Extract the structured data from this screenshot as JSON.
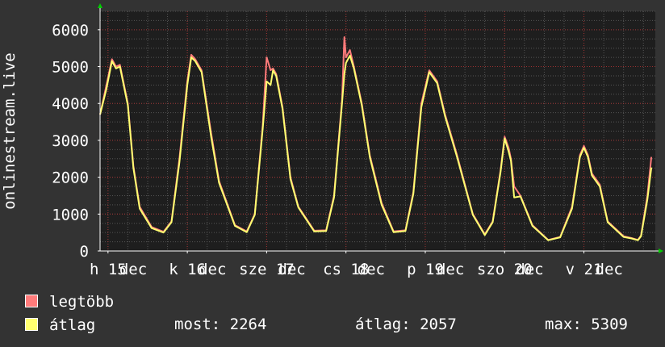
{
  "colors": {
    "background": "#333333",
    "plot": "#1e1e1e",
    "grid": "#555555",
    "major_grid": "#a03030",
    "max_series": "#ff7b7b",
    "avg_series": "#ffff70",
    "arrow": "#00cc00"
  },
  "legend": {
    "max_label": "legtöbb",
    "avg_label": "átlag",
    "now": "most: 2264",
    "average": "átlag: 2057",
    "maximum": "max: 5309"
  },
  "chart_data": {
    "type": "line",
    "ylabel": "onlinestream.live",
    "ylim": [
      0,
      6500
    ],
    "yticks": [
      0,
      1000,
      2000,
      3000,
      4000,
      5000,
      6000
    ],
    "yticklabels": [
      "0",
      "1000",
      "2000",
      "3000",
      "4000",
      "5000",
      "6000"
    ],
    "xlim": [
      -0.1,
      6.9
    ],
    "xticks": [
      0,
      1,
      2,
      3,
      4,
      5,
      6
    ],
    "xticklabels": [
      "h 15",
      "k 16",
      "sze 17",
      "cs 18",
      "p 19",
      "szo 20",
      "v 21"
    ],
    "xrotatedlabels": [
      "dec",
      "dec",
      "dec",
      "dec",
      "dec",
      "dec",
      "dec"
    ],
    "series": [
      {
        "name": "legtöbb",
        "x": [
          -0.1,
          -0.02,
          0.05,
          0.1,
          0.15,
          0.25,
          0.32,
          0.4,
          0.55,
          0.7,
          0.8,
          0.9,
          1.0,
          1.05,
          1.1,
          1.18,
          1.3,
          1.4,
          1.6,
          1.75,
          1.85,
          1.95,
          2.0,
          2.05,
          2.08,
          2.12,
          2.2,
          2.3,
          2.4,
          2.6,
          2.75,
          2.85,
          2.95,
          2.98,
          3.0,
          3.05,
          3.1,
          3.2,
          3.3,
          3.45,
          3.6,
          3.75,
          3.85,
          3.95,
          4.05,
          4.15,
          4.25,
          4.4,
          4.6,
          4.75,
          4.85,
          4.95,
          5.0,
          5.05,
          5.08,
          5.12,
          5.2,
          5.35,
          5.55,
          5.7,
          5.85,
          5.95,
          6.0,
          6.05,
          6.1,
          6.2,
          6.3,
          6.5,
          6.6,
          6.68,
          6.72,
          6.8,
          6.85
        ],
        "values": [
          3700,
          4500,
          5200,
          5000,
          5050,
          4000,
          2300,
          1200,
          650,
          520,
          800,
          2500,
          4600,
          5320,
          5200,
          4900,
          3200,
          1900,
          700,
          530,
          1000,
          3400,
          5250,
          4900,
          4950,
          4800,
          3900,
          2000,
          1200,
          550,
          560,
          1500,
          4100,
          5800,
          5250,
          5450,
          5000,
          4000,
          2600,
          1300,
          530,
          560,
          1600,
          4000,
          4900,
          4600,
          3700,
          2600,
          1000,
          450,
          800,
          2200,
          3100,
          2800,
          2500,
          1750,
          1500,
          700,
          300,
          380,
          1200,
          2600,
          2850,
          2600,
          2100,
          1800,
          800,
          400,
          350,
          300,
          420,
          1500,
          2550
        ]
      },
      {
        "name": "átlag",
        "x": [
          -0.1,
          -0.02,
          0.05,
          0.1,
          0.15,
          0.25,
          0.32,
          0.4,
          0.55,
          0.7,
          0.8,
          0.9,
          1.0,
          1.05,
          1.1,
          1.18,
          1.3,
          1.4,
          1.6,
          1.75,
          1.85,
          1.95,
          2.0,
          2.05,
          2.08,
          2.12,
          2.2,
          2.3,
          2.4,
          2.6,
          2.75,
          2.85,
          2.95,
          2.98,
          3.0,
          3.05,
          3.1,
          3.2,
          3.3,
          3.45,
          3.6,
          3.75,
          3.85,
          3.95,
          4.05,
          4.15,
          4.25,
          4.4,
          4.6,
          4.75,
          4.85,
          4.95,
          5.0,
          5.05,
          5.08,
          5.12,
          5.2,
          5.35,
          5.55,
          5.7,
          5.85,
          5.95,
          6.0,
          6.05,
          6.1,
          6.2,
          6.3,
          6.5,
          6.6,
          6.68,
          6.72,
          6.8,
          6.85
        ],
        "values": [
          3700,
          4400,
          5150,
          4950,
          5000,
          3950,
          2250,
          1150,
          620,
          500,
          780,
          2400,
          4500,
          5250,
          5150,
          4850,
          3100,
          1850,
          680,
          510,
          980,
          3300,
          4600,
          4500,
          4900,
          4750,
          3850,
          1950,
          1180,
          530,
          540,
          1450,
          4000,
          4800,
          5100,
          5300,
          4950,
          3950,
          2550,
          1250,
          510,
          540,
          1550,
          3900,
          4850,
          4550,
          3650,
          2550,
          980,
          430,
          780,
          2150,
          3050,
          2700,
          2450,
          1450,
          1480,
          680,
          290,
          370,
          1150,
          2550,
          2800,
          2550,
          2050,
          1750,
          780,
          380,
          340,
          290,
          400,
          1400,
          2264
        ]
      }
    ]
  }
}
